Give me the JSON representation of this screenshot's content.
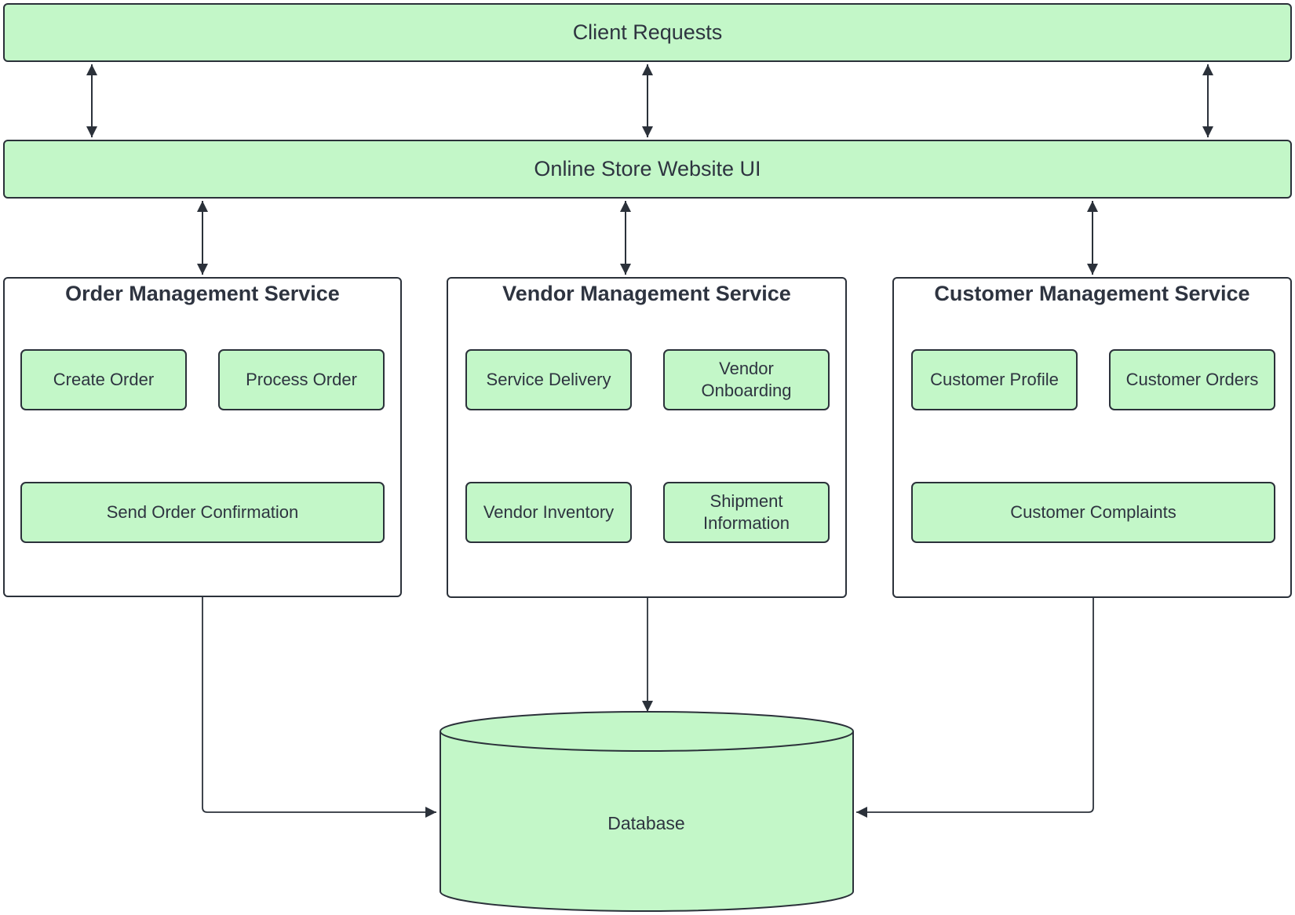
{
  "diagram": {
    "top_layers": [
      {
        "id": "client-requests",
        "label": "Client Requests"
      },
      {
        "id": "online-store-ui",
        "label": "Online Store Website UI"
      }
    ],
    "services": [
      {
        "id": "order-management-service",
        "title": "Order Management Service",
        "components": [
          "Create Order",
          "Process Order",
          "Send Order Confirmation"
        ]
      },
      {
        "id": "vendor-management-service",
        "title": "Vendor Management Service",
        "components": [
          "Service  Delivery",
          "Vendor\nOnboarding",
          "Vendor Inventory",
          "Shipment\nInformation"
        ]
      },
      {
        "id": "customer-management-service",
        "title": "Customer Management Service",
        "components": [
          "Customer Profile",
          "Customer Orders",
          "Customer Complaints"
        ]
      }
    ],
    "database": {
      "label": "Database"
    },
    "connections": [
      {
        "from": "Client Requests",
        "to": "Online Store Website UI",
        "type": "bidirectional",
        "count": 3
      },
      {
        "from": "Online Store Website UI",
        "to": "Order Management Service",
        "type": "bidirectional"
      },
      {
        "from": "Online Store Website UI",
        "to": "Vendor Management Service",
        "type": "bidirectional"
      },
      {
        "from": "Online Store Website UI",
        "to": "Customer Management Service",
        "type": "bidirectional"
      },
      {
        "from": "Order Management Service",
        "to": "Database",
        "type": "directed"
      },
      {
        "from": "Vendor Management Service",
        "to": "Database",
        "type": "directed"
      },
      {
        "from": "Customer Management Service",
        "to": "Database",
        "type": "directed"
      }
    ],
    "colors": {
      "fill": "#c3f7c8",
      "stroke": "#2b313a",
      "text": "#2e3440"
    }
  }
}
